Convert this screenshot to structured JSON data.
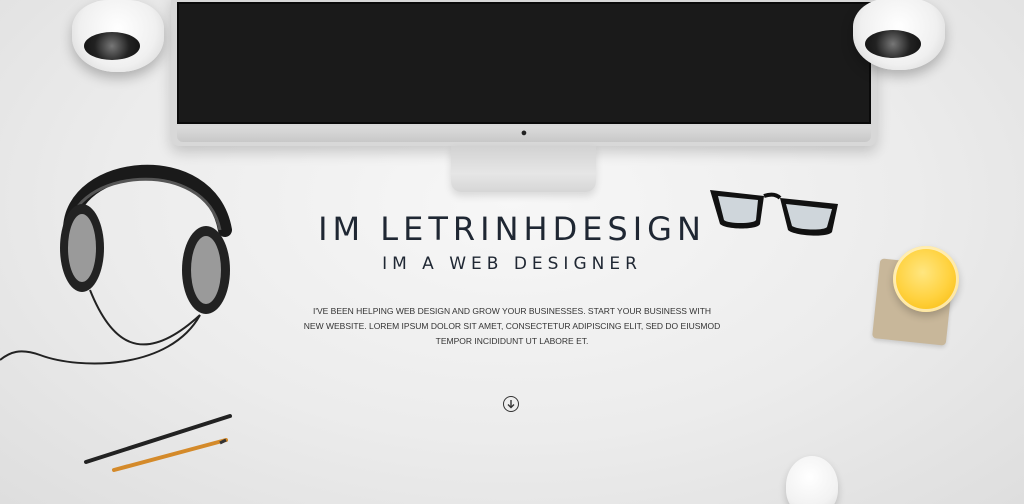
{
  "hero": {
    "title": "IM LETRINHDESIGN",
    "subtitle": "IM A WEB DESIGNER",
    "description": "I'VE BEEN HELPING WEB DESIGN AND GROW YOUR BUSINESSES. START YOUR BUSINESS WITH NEW WEBSITE. LOREM IPSUM DOLOR SIT AMET, CONSECTETUR ADIPISCING ELIT, SED DO EIUSMOD TEMPOR INCIDIDUNT UT LABORE ET."
  },
  "scroll_icon": "arrow-down-circle-icon",
  "colors": {
    "text": "#1f2733",
    "background": "#ececec",
    "juice": "#ffd23f"
  }
}
